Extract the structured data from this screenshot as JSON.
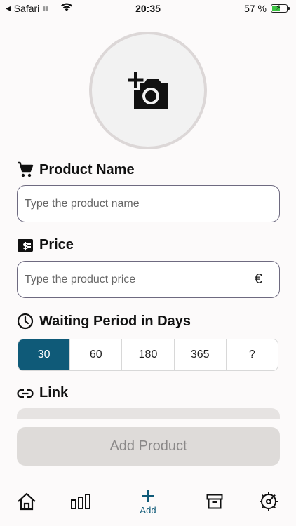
{
  "status_bar": {
    "back_app": "Safari",
    "time": "20:35",
    "battery_percent": "57 %",
    "battery_level": 0.57
  },
  "photo": {
    "icon": "add-photo-icon"
  },
  "product_name": {
    "label": "Product Name",
    "icon": "cart-icon",
    "placeholder": "Type the product name",
    "value": ""
  },
  "price": {
    "label": "Price",
    "icon": "money-icon",
    "placeholder": "Type the product price",
    "value": "",
    "currency": "€"
  },
  "waiting_period": {
    "label": "Waiting Period in Days",
    "icon": "clock-icon",
    "options": [
      "30",
      "60",
      "180",
      "365",
      "?"
    ],
    "selected": "30"
  },
  "link": {
    "label": "Link",
    "icon": "link-icon"
  },
  "actions": {
    "add_product_label": "Add Product"
  },
  "tab_bar": {
    "active_label": "Add",
    "accent_color": "#0f5a78"
  }
}
